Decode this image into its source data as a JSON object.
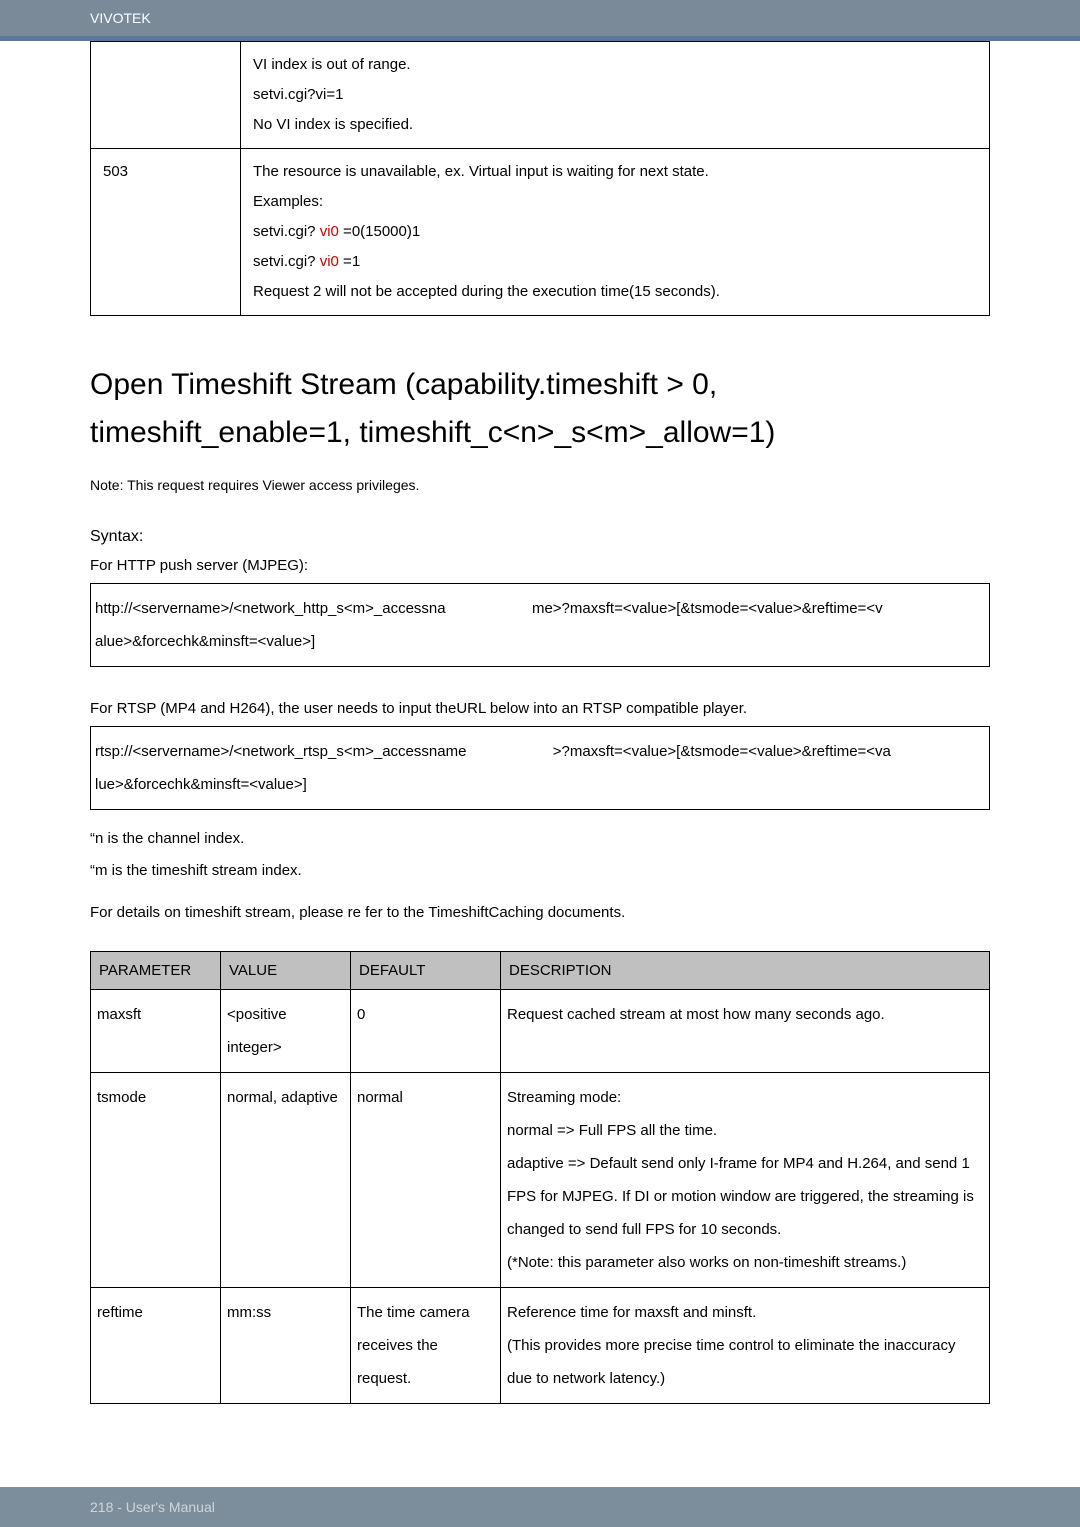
{
  "header": {
    "brand": "VIVOTEK"
  },
  "topTable": {
    "row1": {
      "line1": "VI index is out of range.",
      "line2": "setvi.cgi?vi=1",
      "line3": "No VI index is specified."
    },
    "row2": {
      "code": "503",
      "line1": "The resource is unavailable, ex. Virtual input is waiting for next state.",
      "line2": "Examples:",
      "line3a": "setvi.cgi? ",
      "line3b": "vi0",
      "line3c": " =0(15000)1",
      "line4a": "setvi.cgi? ",
      "line4b": "vi0",
      "line4c": " =1",
      "line5": "Request 2 will not be accepted during the execution time(15 seconds)."
    }
  },
  "heading": {
    "line1": "Open Timeshift Stream (capability.timeshift > 0,",
    "line2": "timeshift_enable=1, timeshift_c<n>_s<m>_allow=1)"
  },
  "noteLine": "Note:   This request requires Viewer access privileges.",
  "syntax": {
    "label": "Syntax:",
    "httpLabel": "For HTTP push server (MJPEG):",
    "httpBox": "http://<servername>/<network_http_s<m>_accessna              me>?maxsft=<value>[&tsmode=<value>&reftime=<v\nalue>&forcechk&minsft=<value>]",
    "rtspLabel": "For RTSP (MP4 and H264), the user needs to input theURL below into an RTSP compatible player.",
    "rtspBox": "rtsp://<servername>/<network_rtsp_s<m>_accessname              >?maxsft=<value>[&tsmode=<value>&reftime=<va\nlue>&forcechk&minsft=<value>]"
  },
  "notes": {
    "n": "“n  is the channel index.",
    "m": "“m  is the timeshift stream index.",
    "details": "For details on timeshift stream, please re           fer to the  TimeshiftCaching  documents."
  },
  "paramsTable": {
    "headers": {
      "parameter": "PARAMETER",
      "value": "VALUE",
      "default": "DEFAULT",
      "description": "DESCRIPTION"
    },
    "rows": [
      {
        "param": "maxsft",
        "value": "<positive integer>",
        "default": "0",
        "desc": "Request cached stream at most how many seconds ago."
      },
      {
        "param": "tsmode",
        "value": "normal, adaptive",
        "default": "normal",
        "desc": "Streaming mode:\nnormal => Full FPS all the time.\nadaptive => Default send only I-frame for MP4 and H.264, and send 1 FPS for MJPEG. If DI or motion window are triggered, the streaming is changed to send full FPS for 10 seconds.\n(*Note: this parameter also works on non-timeshift streams.)"
      },
      {
        "param": "reftime",
        "value": "mm:ss",
        "default": "The time camera receives the request.",
        "desc": "Reference time for maxsft and minsft.\n(This provides more precise time control to eliminate the inaccuracy due to network latency.)"
      }
    ]
  },
  "footer": {
    "pageLabel": "218 - User's Manual"
  }
}
